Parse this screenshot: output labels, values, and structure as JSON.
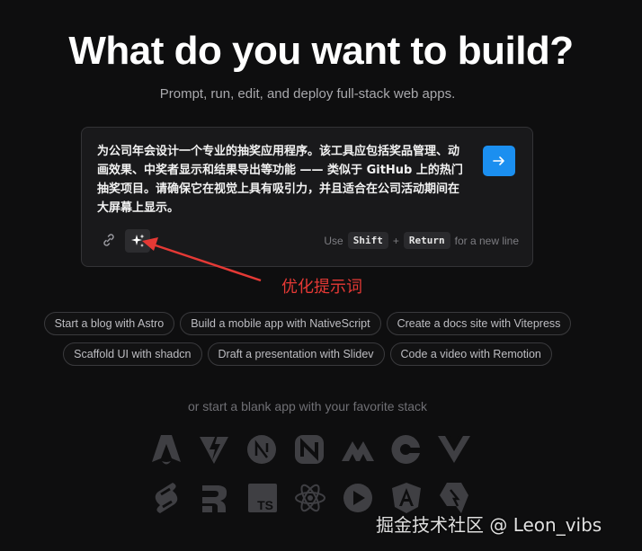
{
  "header": {
    "title": "What do you want to build?",
    "subtitle": "Prompt, run, edit, and deploy full-stack web apps."
  },
  "prompt": {
    "text": "为公司年会设计一个专业的抽奖应用程序。该工具应包括奖品管理、动画效果、中奖者显示和结果导出等功能 —— 类似于 GitHub 上的热门抽奖项目。请确保它在视觉上具有吸引力，并且适合在公司活动期间在大屏幕上显示。",
    "hint_use": "Use",
    "hint_shift": "Shift",
    "hint_plus": "+",
    "hint_return": "Return",
    "hint_suffix": "for a new line"
  },
  "annotation": {
    "label": "优化提示词",
    "color": "#e53935"
  },
  "suggestions": {
    "row1": [
      "Start a blog with Astro",
      "Build a mobile app with NativeScript",
      "Create a docs site with Vitepress"
    ],
    "row2": [
      "Scaffold UI with shadcn",
      "Draft a presentation with Slidev",
      "Code a video with Remotion"
    ]
  },
  "blank_app_text": "or start a blank app with your favorite stack",
  "stacks": {
    "row1": [
      "astro-icon",
      "vite-icon",
      "next-icon",
      "nuxt-icon",
      "vue-icon-m",
      "qwik-icon",
      "vue-icon"
    ],
    "row2": [
      "svelte-icon",
      "remix-icon",
      "typescript-icon",
      "react-icon",
      "slidev-icon",
      "angular-icon",
      "qwik-alt-icon"
    ]
  },
  "ts_badge": "TS",
  "watermark": "掘金技术社区 @ Leon_vibs",
  "colors": {
    "accent": "#1b8ff0",
    "background": "#0e0e0f",
    "card": "#19191b"
  }
}
